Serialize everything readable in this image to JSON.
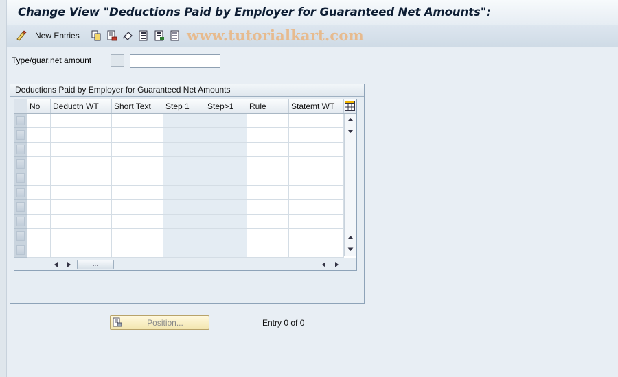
{
  "window": {
    "title": "Change View \"Deductions Paid by Employer for Guaranteed Net Amounts\":"
  },
  "toolbar": {
    "new_entries_label": "New Entries",
    "watermark": "www.tutorialkart.com",
    "icons": [
      "display-change-icon",
      "copy-icon",
      "delete-icon",
      "undo-icon",
      "select-all-icon",
      "select-block-icon",
      "deselect-all-icon"
    ]
  },
  "filter": {
    "label": "Type/guar.net amount",
    "value": ""
  },
  "group": {
    "title": "Deductions Paid by Employer for Guaranteed Net Amounts"
  },
  "table": {
    "columns": [
      "No",
      "Deductn WT",
      "Short Text",
      "Step 1",
      "Step>1",
      "Rule",
      "Statemt WT"
    ],
    "row_count": 10,
    "rows": []
  },
  "footer": {
    "position_button_label": "Position...",
    "entry_count": "Entry 0 of 0"
  },
  "colors": {
    "title_text": "#0d1d33",
    "watermark": "#e8b98a",
    "shaded_column": "#e4ecf3"
  }
}
